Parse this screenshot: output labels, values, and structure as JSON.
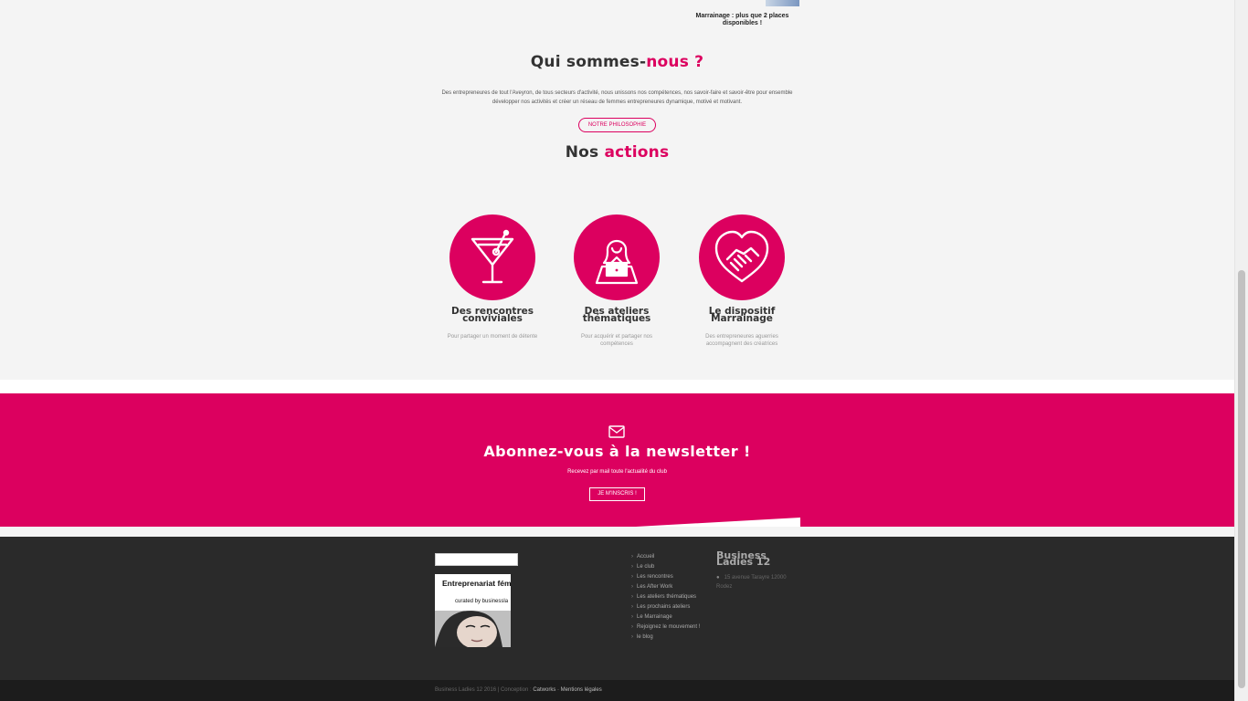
{
  "top": {
    "marrainage_note": "Marrainage : plus que 2 places disponibles !"
  },
  "about": {
    "title_main": "Qui sommes-",
    "title_accent": "nous ?",
    "text": "Des entrepreneures de tout l'Aveyron, de tous secteurs d'activité, nous unissons nos compétences, nos savoir-faire et savoir-être pour ensemble développer nos activités et créer un réseau de femmes entrepreneures dynamique, motivé et motivant.",
    "button": "NOTRE PHILOSOPHIE"
  },
  "actions": {
    "title_main": "Nos ",
    "title_accent": "actions",
    "items": [
      {
        "title": "Des rencontres conviviales",
        "desc": "Pour partager un moment de détente",
        "icon": "cocktail-icon"
      },
      {
        "title": "Des ateliers thématiques",
        "desc": "Pour acquérir et partager nos compétences",
        "icon": "woman-laptop-icon"
      },
      {
        "title": "Le dispositif Marrainage",
        "desc": "Des entrepreneures aguerries accompagnent des créatrices",
        "icon": "heart-handshake-icon"
      }
    ]
  },
  "newsletter": {
    "title": "Abonnez-vous à la newsletter !",
    "subtitle": "Recevez par mail toute l'actualité du club",
    "button": "JE M'INSCRIS !",
    "icon": "envelope-icon"
  },
  "footer": {
    "widget": {
      "title": "Entreprenariat fém",
      "subtitle": "curated by businessla"
    },
    "nav": [
      "Accueil",
      "Le club",
      "Les rencontres",
      "Les After Work",
      "Les ateliers thématiques",
      "Les prochains ateliers",
      "Le Marrainage",
      "Rejoignez le mouvement !",
      "le blog"
    ],
    "brand": "Business Ladies 12",
    "address": "15 avenue Tarayre 12000 Rodez",
    "copyright_prefix": "Business Ladies 12  2016 | Conception :",
    "link_catworks": "Catworks",
    "separator": " - ",
    "link_mentions": "Mentions légales"
  },
  "colors": {
    "accent": "#dc005f",
    "footer_bg": "#2a2a2a",
    "bottom_bar": "#1c1c1c"
  }
}
